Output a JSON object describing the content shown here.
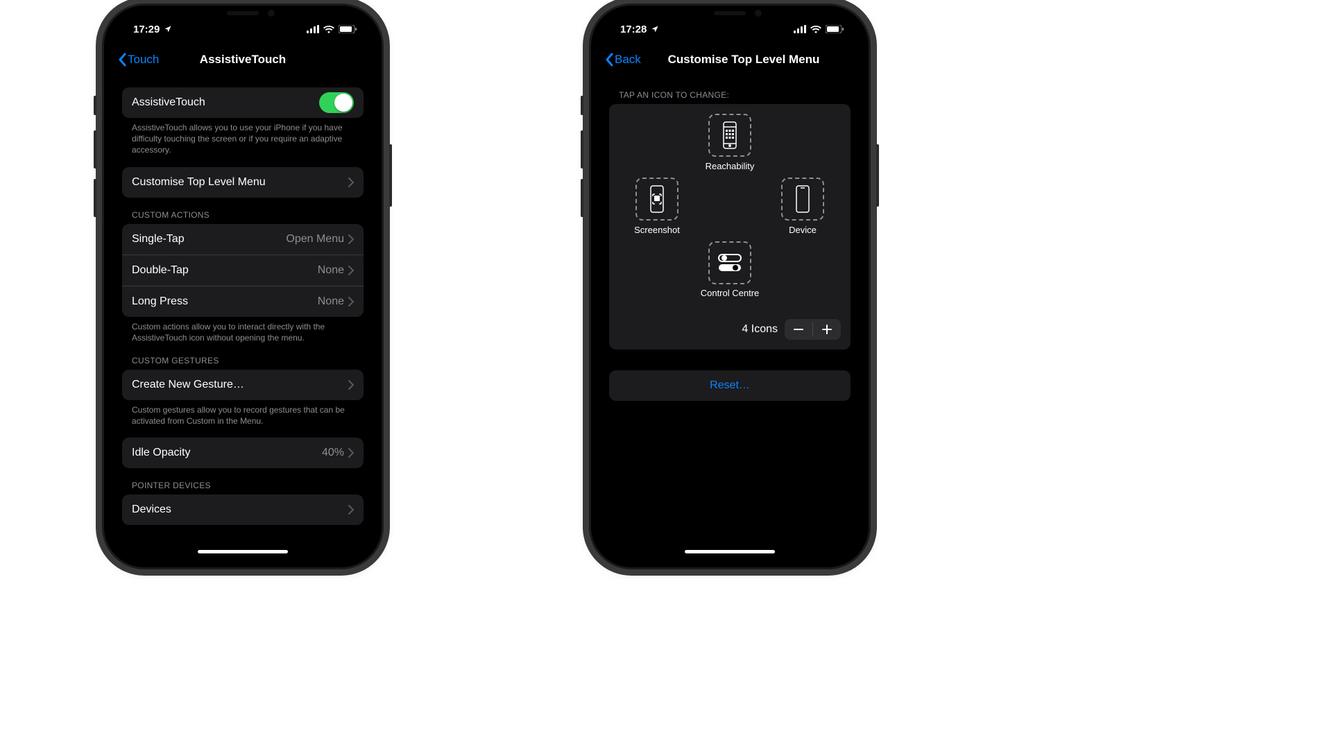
{
  "left": {
    "status": {
      "time": "17:29"
    },
    "nav": {
      "back": "Touch",
      "title": "AssistiveTouch"
    },
    "toggle": {
      "label": "AssistiveTouch",
      "on": true
    },
    "toggle_footer": "AssistiveTouch allows you to use your iPhone if you have difficulty touching the screen or if you require an adaptive accessory.",
    "customise_row": "Customise Top Level Menu",
    "custom_actions_header": "CUSTOM ACTIONS",
    "actions": {
      "single": {
        "label": "Single-Tap",
        "value": "Open Menu"
      },
      "double": {
        "label": "Double-Tap",
        "value": "None"
      },
      "long": {
        "label": "Long Press",
        "value": "None"
      }
    },
    "actions_footer": "Custom actions allow you to interact directly with the AssistiveTouch icon without opening the menu.",
    "gestures_header": "CUSTOM GESTURES",
    "gestures_row": "Create New Gesture…",
    "gestures_footer": "Custom gestures allow you to record gestures that can be activated from Custom in the Menu.",
    "idle": {
      "label": "Idle Opacity",
      "value": "40%"
    },
    "pointer_header": "POINTER DEVICES",
    "devices_row": "Devices"
  },
  "right": {
    "status": {
      "time": "17:28"
    },
    "nav": {
      "back": "Back",
      "title": "Customise Top Level Menu"
    },
    "header": "TAP AN ICON TO CHANGE:",
    "icons": {
      "top": "Reachability",
      "left": "Screenshot",
      "right": "Device",
      "bottom": "Control Centre"
    },
    "count_label": "4 Icons",
    "reset": "Reset…"
  }
}
